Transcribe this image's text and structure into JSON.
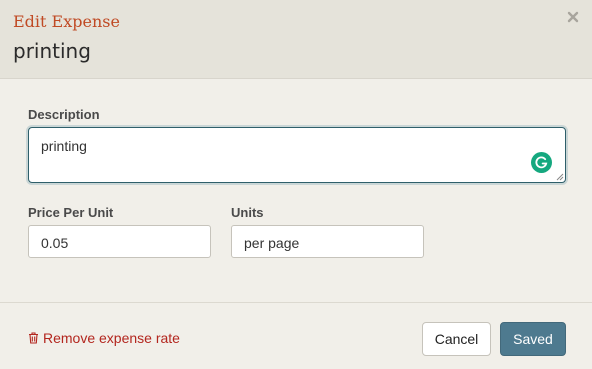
{
  "modal": {
    "title": "Edit Expense",
    "subtitle": "printing"
  },
  "form": {
    "description": {
      "label": "Description",
      "value": "printing"
    },
    "price_per_unit": {
      "label": "Price Per Unit",
      "value": "0.05"
    },
    "units": {
      "label": "Units",
      "value": "per page"
    }
  },
  "footer": {
    "remove_label": "Remove expense rate",
    "cancel_label": "Cancel",
    "saved_label": "Saved"
  },
  "colors": {
    "title": "#c04a24",
    "remove_link": "#b3261e",
    "primary_button": "#4e7a8f",
    "grammarly": "#15a87f"
  },
  "icons": [
    "close-icon",
    "grammarly-icon",
    "trash-icon"
  ]
}
